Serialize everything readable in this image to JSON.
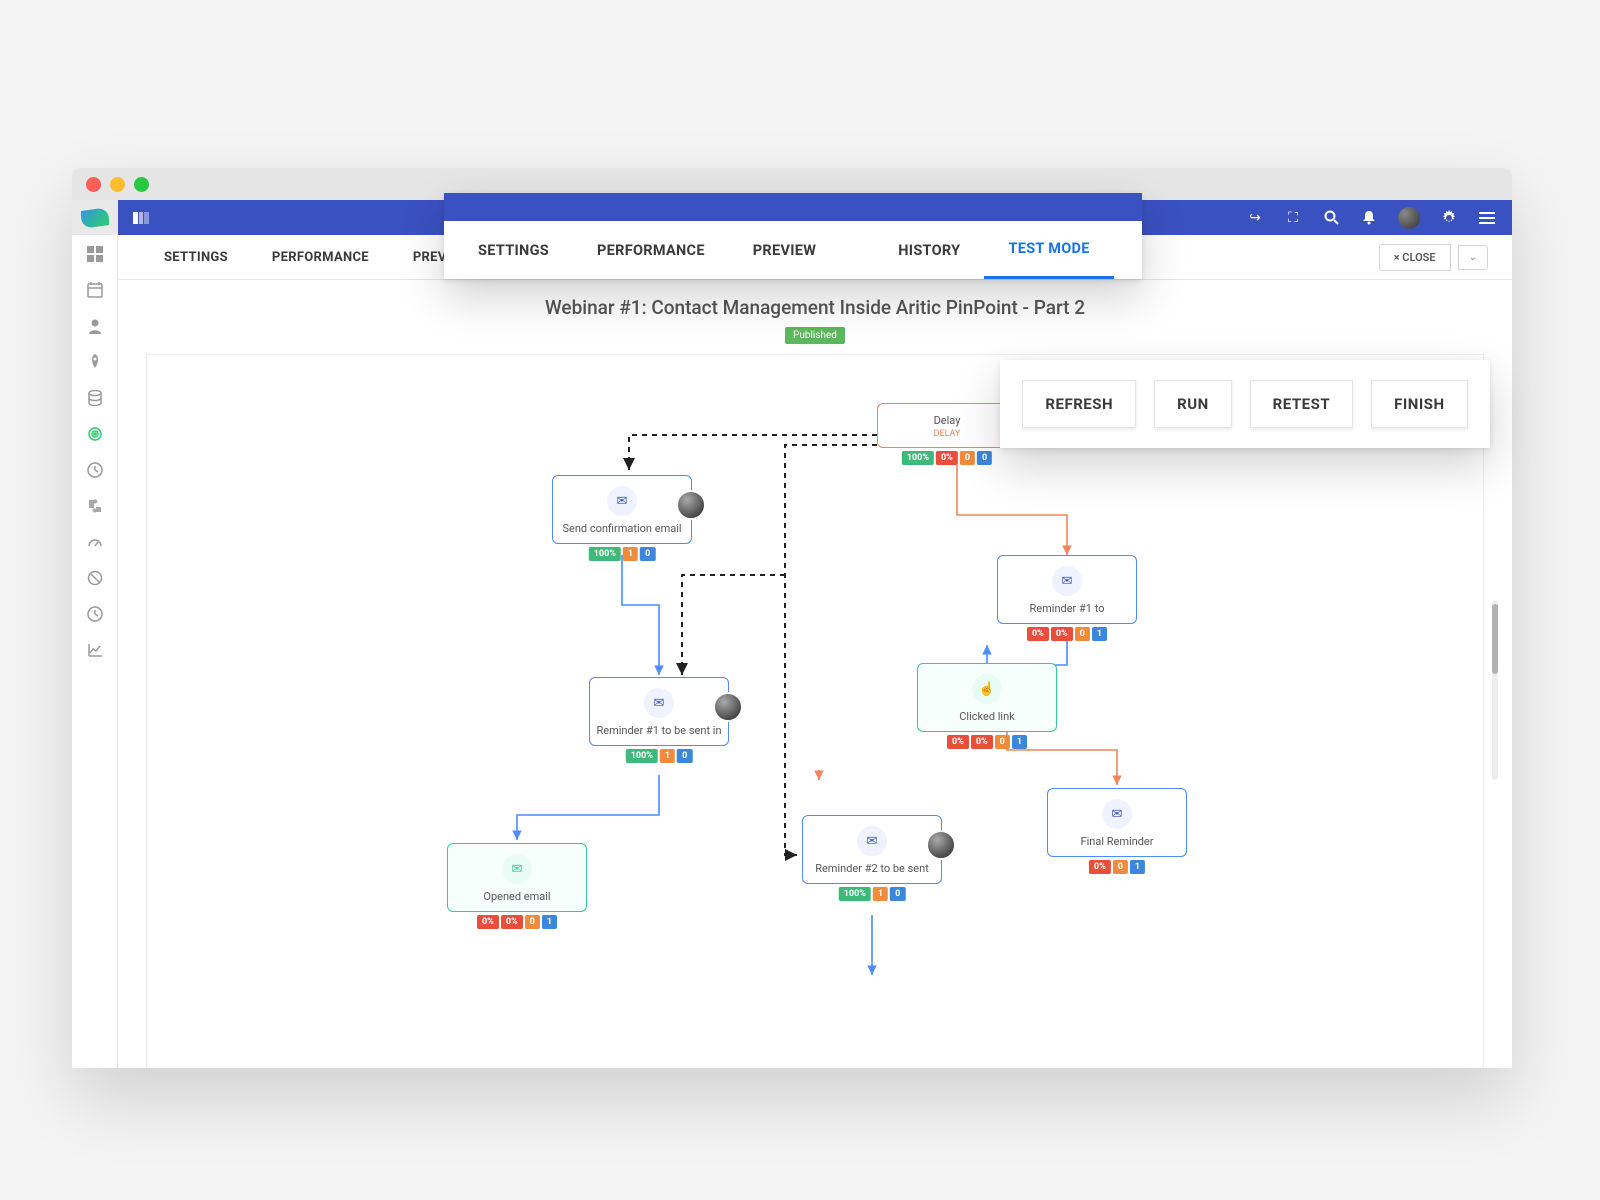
{
  "page": {
    "title": "Webinar #1: Contact Management Inside Aritic PinPoint - Part 2",
    "status": "Published"
  },
  "header": {
    "icons": [
      "share",
      "expand",
      "search",
      "bell",
      "avatar",
      "settings",
      "menu"
    ]
  },
  "tabs": [
    "SETTINGS",
    "PERFORMANCE",
    "PREVIEW",
    "HISTORY",
    "TEST MODE"
  ],
  "activeTab": "TEST MODE",
  "closeButton": "× CLOSE",
  "sidebar": [
    "grid",
    "calendar",
    "user",
    "rocket",
    "database",
    "target",
    "clock",
    "puzzle",
    "gauge",
    "ban",
    "clock2",
    "chart"
  ],
  "actions": [
    "REFRESH",
    "RUN",
    "RETEST",
    "FINISH"
  ],
  "nodes": {
    "delay": {
      "title": "Delay",
      "sub": "DELAY",
      "badges": [
        "100%",
        "0%",
        "0",
        "0"
      ]
    },
    "confirm": {
      "title": "Send confirmation email",
      "badges": [
        "100%",
        "1",
        "0"
      ]
    },
    "rem1": {
      "title": "Reminder #1 to",
      "badges": [
        "0%",
        "0%",
        "0",
        "1"
      ]
    },
    "clicked": {
      "title": "Clicked link",
      "badges": [
        "0%",
        "0%",
        "0",
        "1"
      ]
    },
    "rem1b": {
      "title": "Reminder #1 to be sent in",
      "badges": [
        "100%",
        "1",
        "0"
      ]
    },
    "rem2": {
      "title": "Reminder #2 to be sent",
      "badges": [
        "100%",
        "1",
        "0"
      ]
    },
    "final": {
      "title": "Final Reminder",
      "badges": [
        "0%",
        "0",
        "1"
      ]
    },
    "opened": {
      "title": "Opened email",
      "badges": [
        "0%",
        "0%",
        "0",
        "1"
      ]
    }
  }
}
